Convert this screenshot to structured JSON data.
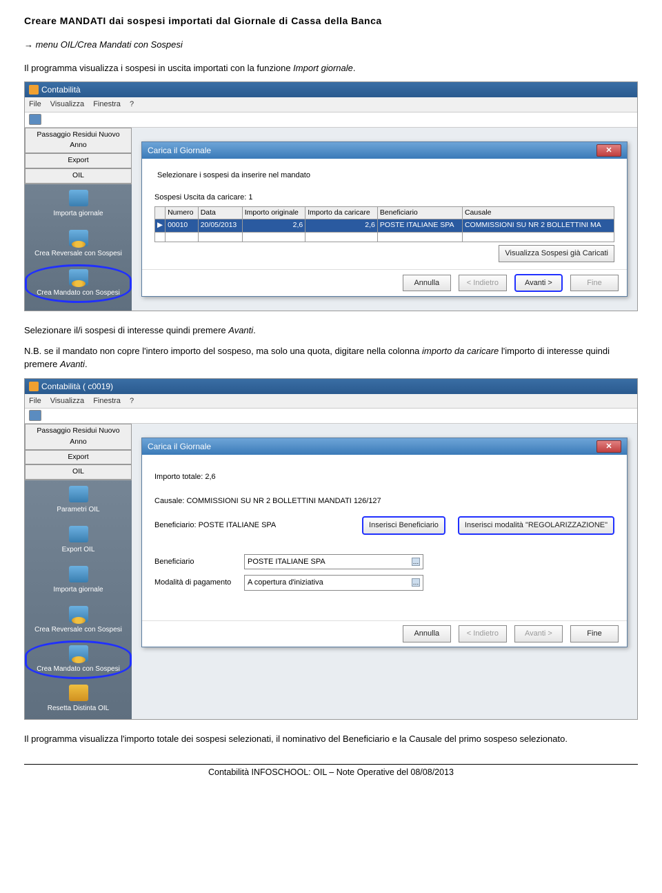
{
  "doc": {
    "title": "Creare MANDATI dai sospesi importati dal Giornale di Cassa della Banca",
    "menu_path": "→ menu OIL/Crea Mandati con Sospesi",
    "intro": "Il programma visualizza i sospesi in uscita importati con la funzione Import giornale.",
    "mid1": "Selezionare il/i sospesi di interesse quindi premere Avanti.",
    "mid2": "N.B. se il mandato non copre l'intero importo del sospeso, ma solo una quota, digitare nella colonna importo da caricare l'importo di interesse quindi premere Avanti.",
    "out1": "Il programma visualizza l'importo totale dei sospesi selezionati, il nominativo del Beneficiario e la Causale del primo sospeso selezionato.",
    "footer": "Contabilità INFOSCHOOL: OIL – Note Operative del 08/08/2013"
  },
  "ss1": {
    "titlebar": "Contabilità",
    "menus": [
      "File",
      "Visualizza",
      "Finestra",
      "?"
    ],
    "side_btns": [
      "Passaggio Residui Nuovo Anno",
      "Export",
      "OIL"
    ],
    "side_items": [
      "Importa giornale",
      "Crea Reversale con Sospesi",
      "Crea Mandato con Sospesi"
    ],
    "dlg_title": "Carica il Giornale",
    "dlg_instr": "Selezionare i sospesi da inserire nel mandato",
    "count_label": "Sospesi Uscita da caricare: 1",
    "headers": [
      "",
      "Numero",
      "Data",
      "Importo originale",
      "Importo da caricare",
      "Beneficiario",
      "Causale"
    ],
    "row": {
      "num": "00010",
      "data": "20/05/2013",
      "imp_orig": "2,6",
      "imp_car": "2,6",
      "benef": "POSTE ITALIANE SPA",
      "caus": "COMMISSIONI SU NR 2 BOLLETTINI MA"
    },
    "btn_view": "Visualizza Sospesi già Caricati",
    "btn_cancel": "Annulla",
    "btn_back": "< Indietro",
    "btn_next": "Avanti >",
    "btn_end": "Fine"
  },
  "ss2": {
    "titlebar": "Contabilità ( c0019)",
    "menus": [
      "File",
      "Visualizza",
      "Finestra",
      "?"
    ],
    "side_btns": [
      "Passaggio Residui Nuovo Anno",
      "Export",
      "OIL"
    ],
    "side_items": [
      "Parametri OIL",
      "Export OIL",
      "Importa giornale",
      "Crea Reversale con Sospesi",
      "Crea Mandato con Sospesi",
      "Resetta Distinta OIL"
    ],
    "dlg_title": "Carica il Giornale",
    "totale": "Importo totale: 2,6",
    "causale": "Causale: COMMISSIONI SU NR 2 BOLLETTINI MANDATI 126/127",
    "benef_line": "Beneficiario: POSTE ITALIANE SPA",
    "btn_ins_benef": "Inserisci Beneficiario",
    "btn_ins_regol": "Inserisci modalità \"REGOLARIZZAZIONE\"",
    "lbl_benef": "Beneficiario",
    "val_benef": "POSTE ITALIANE SPA",
    "lbl_modal": "Modalità di pagamento",
    "val_modal": "A copertura d'iniziativa",
    "btn_cancel": "Annulla",
    "btn_back": "< Indietro",
    "btn_next": "Avanti >",
    "btn_end": "Fine"
  }
}
